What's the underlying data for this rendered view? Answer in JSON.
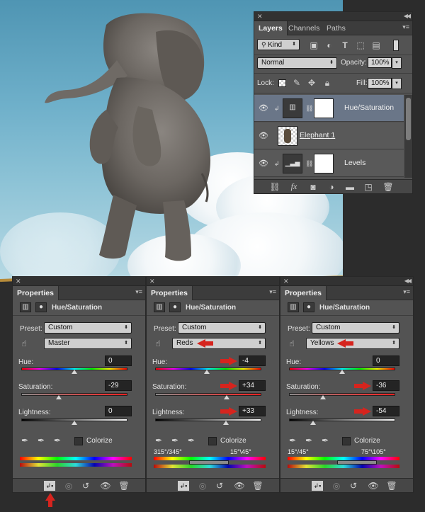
{
  "layers_panel": {
    "tabs": [
      {
        "label": "Layers",
        "active": true
      },
      {
        "label": "Channels",
        "active": false
      },
      {
        "label": "Paths",
        "active": false
      }
    ],
    "filter": {
      "kind_label": "Kind"
    },
    "blend_mode": "Normal",
    "opacity_label": "Opacity:",
    "opacity_value": "100%",
    "lock_label": "Lock:",
    "fill_label": "Fill:",
    "fill_value": "100%",
    "layers": [
      {
        "name": "Hue/Saturation",
        "selected": true
      },
      {
        "name": "Elephant 1",
        "selected": false
      },
      {
        "name": "Levels",
        "selected": false
      }
    ]
  },
  "properties_panels": [
    {
      "tab_label": "Properties",
      "header_title": "Hue/Saturation",
      "preset_label": "Preset:",
      "preset_value": "Custom",
      "channel_value": "Master",
      "hue_label": "Hue:",
      "hue_value": "0",
      "saturation_label": "Saturation:",
      "saturation_value": "-29",
      "lightness_label": "Lightness:",
      "lightness_value": "0",
      "colorize_label": "Colorize",
      "range_left": "",
      "range_right": ""
    },
    {
      "tab_label": "Properties",
      "header_title": "Hue/Saturation",
      "preset_label": "Preset:",
      "preset_value": "Custom",
      "channel_value": "Reds",
      "hue_label": "Hue:",
      "hue_value": "-4",
      "saturation_label": "Saturation:",
      "saturation_value": "+34",
      "lightness_label": "Lightness:",
      "lightness_value": "+33",
      "colorize_label": "Colorize",
      "range_left": "315°/345°",
      "range_right": "15°\\45°"
    },
    {
      "tab_label": "Properties",
      "header_title": "Hue/Saturation",
      "preset_label": "Preset:",
      "preset_value": "Custom",
      "channel_value": "Yellows",
      "hue_label": "Hue:",
      "hue_value": "0",
      "saturation_label": "Saturation:",
      "saturation_value": "-36",
      "lightness_label": "Lightness:",
      "lightness_value": "-54",
      "colorize_label": "Colorize",
      "range_left": "15°/45°",
      "range_right": "75°\\105°"
    }
  ],
  "colors": {
    "panel_bg": "#535353",
    "panel_dark": "#323232",
    "selected_layer": "#6a7688",
    "annotation_red": "#d6241e",
    "sky_top": "#4f95b3"
  }
}
